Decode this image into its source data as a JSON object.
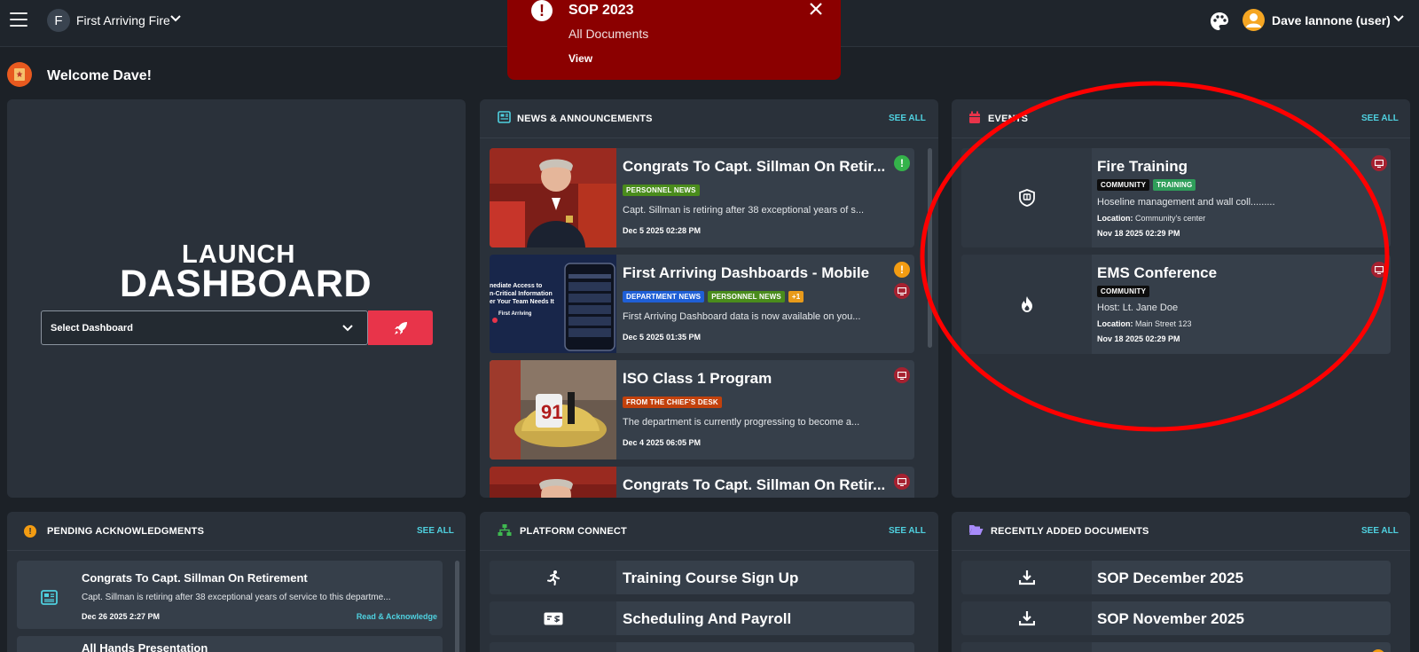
{
  "topbar": {
    "org_initial": "F",
    "org_name": "First Arriving Fire",
    "user_name": "Dave Iannone (user)"
  },
  "toast": {
    "title": "SOP 2023",
    "subtitle": "All Documents",
    "action": "View"
  },
  "welcome": "Welcome Dave!",
  "launch": {
    "line1": "LAUNCH",
    "line2": "DASHBOARD",
    "select_placeholder": "Select Dashboard"
  },
  "news": {
    "title": "NEWS & ANNOUNCEMENTS",
    "see_all": "SEE ALL",
    "items": [
      {
        "title": "Congrats To Capt. Sillman On Retir...",
        "tags": [
          "PERSONNEL NEWS"
        ],
        "desc": "Capt. Sillman is retiring after 38 exceptional years of s...",
        "date": "Dec 5 2025 02:28 PM"
      },
      {
        "title": "First Arriving Dashboards - Mobile",
        "tags": [
          "DEPARTMENT NEWS",
          "PERSONNEL NEWS",
          "+1"
        ],
        "desc": "First Arriving Dashboard data is now available on you...",
        "date": "Dec 5 2025 01:35 PM"
      },
      {
        "title": "ISO Class 1 Program",
        "tags": [
          "FROM THE CHIEF'S DESK"
        ],
        "desc": "The department is currently progressing to become a...",
        "date": "Dec 4 2025 06:05 PM"
      },
      {
        "title": "Congrats To Capt. Sillman On Retir..."
      }
    ],
    "thumb_text": [
      "nediate Access to",
      "n-Critical Information",
      "er Your Team Needs It",
      "First Arriving"
    ]
  },
  "events": {
    "title": "EVENTS",
    "see_all": "SEE ALL",
    "items": [
      {
        "title": "Fire Training",
        "tags": [
          "COMMUNITY",
          "TRAINING"
        ],
        "line": "Hoseline management and wall coll.........",
        "location_label": "Location:",
        "location": "Community's center",
        "date": "Nov 18 2025 02:29 PM"
      },
      {
        "title": "EMS Conference",
        "tags": [
          "COMMUNITY"
        ],
        "line": "Host: Lt. Jane Doe",
        "location_label": "Location:",
        "location": "Main Street 123",
        "date": "Nov 18 2025 02:29 PM"
      }
    ]
  },
  "pending": {
    "title": "PENDING ACKNOWLEDGMENTS",
    "see_all": "SEE ALL",
    "items": [
      {
        "title": "Congrats To Capt. Sillman On Retirement",
        "desc": "Capt. Sillman is retiring after 38 exceptional years of service to this departme...",
        "date": "Dec 26 2025 2:27 PM",
        "action": "Read & Acknowledge"
      },
      {
        "title": "All Hands Presentation"
      }
    ]
  },
  "platform": {
    "title": "PLATFORM CONNECT",
    "see_all": "SEE ALL",
    "items": [
      {
        "label": "Training Course Sign Up"
      },
      {
        "label": "Scheduling And Payroll"
      }
    ]
  },
  "documents": {
    "title": "RECENTLY ADDED DOCUMENTS",
    "see_all": "SEE ALL",
    "items": [
      {
        "label": "SOP December 2025"
      },
      {
        "label": "SOP November 2025"
      }
    ]
  },
  "colors": {
    "accent_cyan": "#4fd1e0",
    "toast_red": "#8b0000",
    "launch_red": "#e8344a",
    "annotation_red": "#ff0000",
    "tag_green": "#4a8c1c",
    "tag_blue": "#1f5fd6",
    "tag_orange": "#c2410c"
  }
}
